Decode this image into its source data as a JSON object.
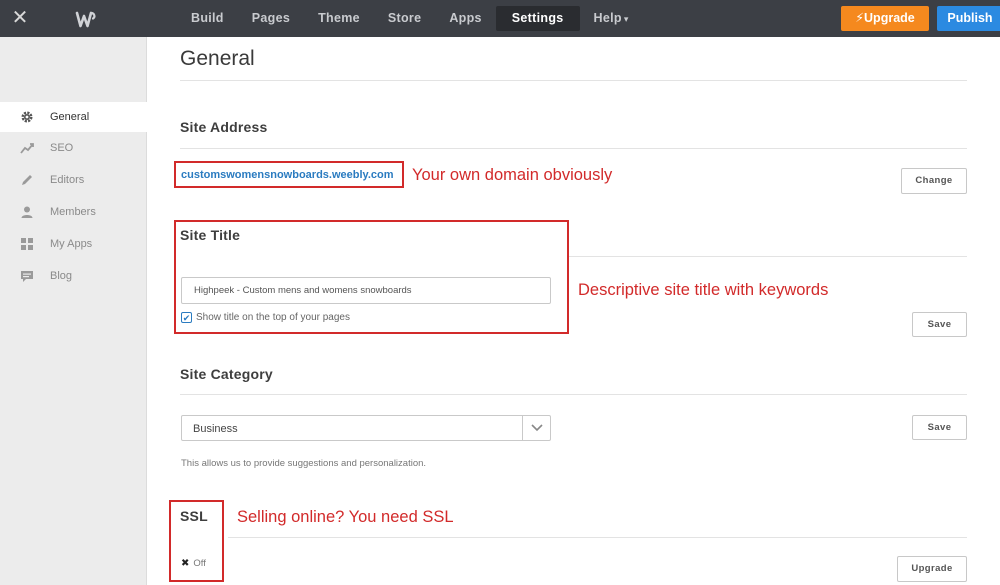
{
  "topbar": {
    "nav": [
      {
        "label": "Build"
      },
      {
        "label": "Pages"
      },
      {
        "label": "Theme"
      },
      {
        "label": "Store"
      },
      {
        "label": "Apps"
      },
      {
        "label": "Settings",
        "active": true
      },
      {
        "label": "Help"
      }
    ],
    "upgrade_label": "Upgrade",
    "publish_label": "Publish",
    "colors": {
      "bar": "#3c3f45",
      "upgrade": "#f5891e",
      "publish": "#2b8ae1"
    }
  },
  "sidebar": {
    "items": [
      {
        "label": "General",
        "icon": "gear-icon",
        "active": true
      },
      {
        "label": "SEO",
        "icon": "trend-icon"
      },
      {
        "label": "Editors",
        "icon": "pencil-icon"
      },
      {
        "label": "Members",
        "icon": "person-icon"
      },
      {
        "label": "My Apps",
        "icon": "grid-icon"
      },
      {
        "label": "Blog",
        "icon": "comment-icon"
      }
    ]
  },
  "main": {
    "page_title": "General",
    "site_address": {
      "title": "Site Address",
      "domain": "customswomensnowboards.weebly.com",
      "change_label": "Change"
    },
    "site_title": {
      "title": "Site Title",
      "value": "Highpeek - Custom mens and womens snowboards",
      "show_title_label": "Show title on the top of your pages",
      "show_title_checked": true,
      "save_label": "Save"
    },
    "site_category": {
      "title": "Site Category",
      "selected": "Business",
      "helper": "This allows us to provide suggestions and personalization.",
      "save_label": "Save"
    },
    "ssl": {
      "title": "SSL",
      "status": "Off",
      "upgrade_label": "Upgrade"
    }
  },
  "annotations": {
    "domain": "Your own domain obviously",
    "title": "Descriptive site title with keywords",
    "ssl": "Selling online? You need SSL",
    "color": "#d22a2a"
  }
}
